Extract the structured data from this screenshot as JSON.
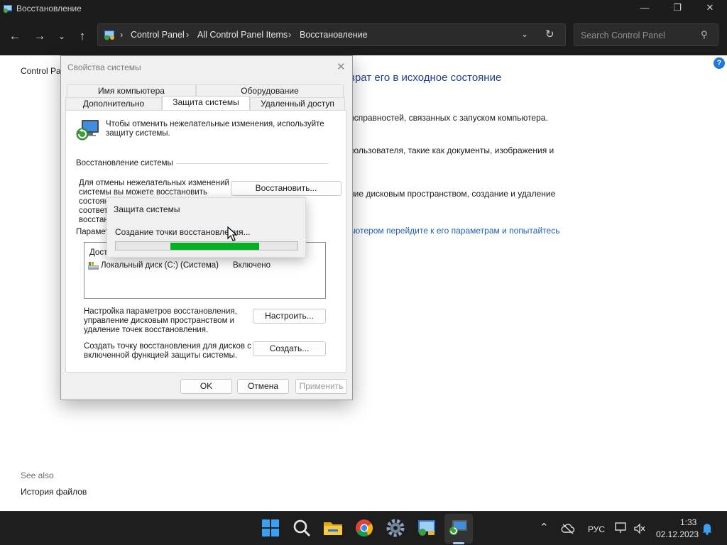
{
  "window": {
    "title": "Восстановление",
    "minimize_icon": "minimize-icon",
    "maximize_icon": "restore-icon",
    "close_icon": "close-icon"
  },
  "address": {
    "crumbs": [
      "Control Panel",
      "All Control Panel Items",
      "Восстановление"
    ],
    "search_placeholder": "Search Control Panel"
  },
  "background": {
    "cp_home": "Control Panel",
    "heading": "врат его в исходное состояние",
    "lines": [
      "исправностей, связанных с запуском компьютера.",
      "пользователя, такие как документы, изображения и",
      "ние дисковым пространством, создание и удаление"
    ],
    "link": "ьютером перейдите к его параметрам и попытайтесь",
    "see_also": "See also",
    "history": "История файлов"
  },
  "dialog": {
    "title": "Свойства системы",
    "tabs": {
      "computer_name": "Имя компьютера",
      "hardware": "Оборудование",
      "advanced": "Дополнительно",
      "protection": "Защита системы",
      "remote": "Удаленный доступ"
    },
    "intro_1": "Чтобы отменить нежелательные изменения, используйте",
    "intro_2": "защиту системы.",
    "restore_group": "Восстановление системы",
    "restore_text_1": "Для отмены нежелательных изменений",
    "restore_text_2": "системы вы можете восстановить",
    "restore_text_3": "состоян",
    "restore_text_4": "соответ",
    "restore_text_5": "восстан",
    "restore_button": "Восстановить...",
    "params_group": "Парамет",
    "drives_header": "Дост",
    "drive_name": "Локальный диск (C:) (Система)",
    "drive_status": "Включено",
    "configure_text_1": "Настройка параметров восстановления,",
    "configure_text_2": "управление дисковым пространством и",
    "configure_text_3": "удаление точек восстановления.",
    "configure_button": "Настроить...",
    "create_text_1": "Создать точку восстановления для дисков с",
    "create_text_2": "включенной функцией защиты системы.",
    "create_button": "Создать...",
    "ok": "OK",
    "cancel": "Отмена",
    "apply": "Применить"
  },
  "progress": {
    "title": "Защита системы",
    "message": "Создание точки восстановления...",
    "fill_start_fraction": 0.3,
    "fill_end_fraction": 0.79
  },
  "taskbar": {
    "lang": "РУС",
    "time": "1:33",
    "date": "02.12.2023"
  },
  "colors": {
    "accent_blue": "#1e78d4",
    "progress_green": "#06b025",
    "titlebar_dark": "#1c1c1c"
  }
}
